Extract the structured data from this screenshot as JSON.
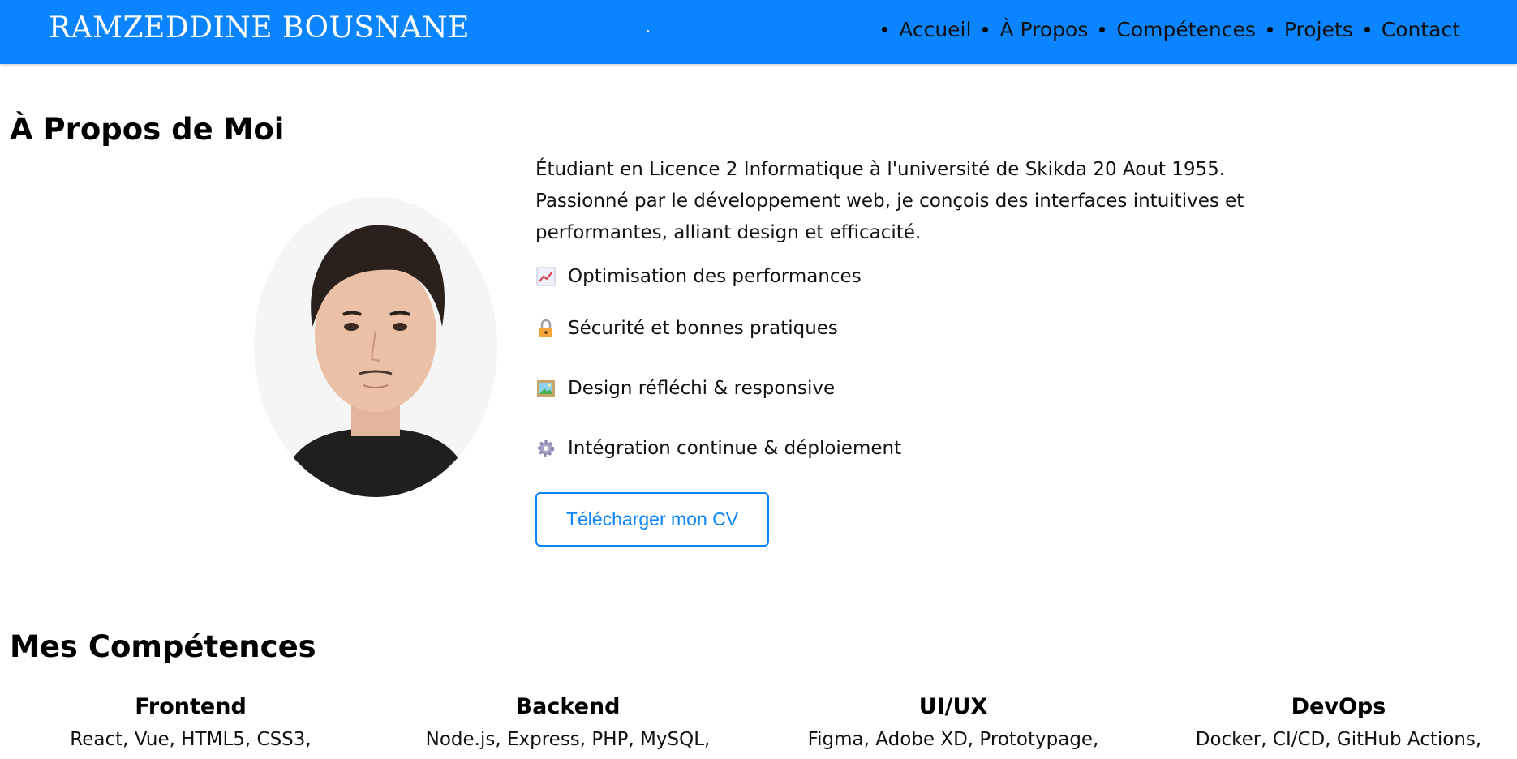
{
  "nav": {
    "brand": "RAMZEDDINE BOUSNANE",
    "links": [
      "Accueil",
      "À Propos",
      "Compétences",
      "Projets",
      "Contact"
    ]
  },
  "about": {
    "title": "À Propos de Moi",
    "description": "Étudiant en Licence 2 Informatique à l'université de Skikda 20 Aout 1955. Passionné par le développement web, je conçois des interfaces intuitives et performantes, alliant design et efficacité.",
    "features": [
      {
        "icon": "chart-increasing-icon",
        "label": "Optimisation des performances"
      },
      {
        "icon": "lock-icon",
        "label": "Sécurité et bonnes pratiques"
      },
      {
        "icon": "framed-picture-icon",
        "label": "Design réfléchi & responsive"
      },
      {
        "icon": "gear-icon",
        "label": "Intégration continue & déploiement"
      }
    ],
    "cv_button": "Télécharger mon CV"
  },
  "skills": {
    "title": "Mes Compétences",
    "categories": [
      {
        "name": "Frontend",
        "items": "React, Vue, HTML5, CSS3,"
      },
      {
        "name": "Backend",
        "items": "Node.js, Express, PHP, MySQL,"
      },
      {
        "name": "UI/UX",
        "items": "Figma, Adobe XD, Prototypage,"
      },
      {
        "name": "DevOps",
        "items": "Docker, CI/CD, GitHub Actions,"
      }
    ]
  },
  "colors": {
    "primary": "#0a84ff",
    "text": "#111111",
    "background": "#ffffff"
  }
}
